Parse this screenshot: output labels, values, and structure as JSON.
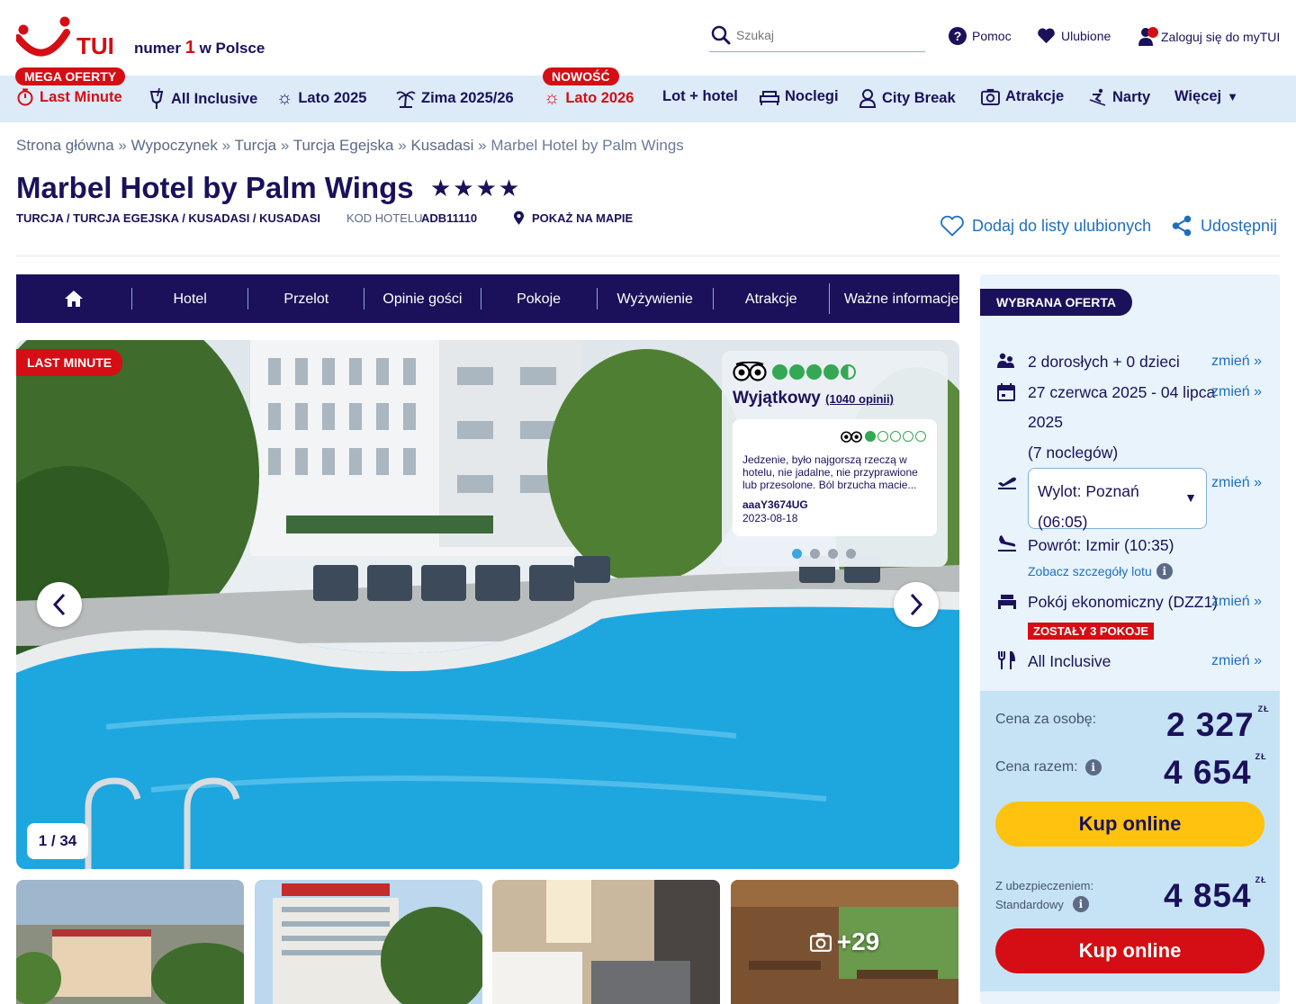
{
  "header": {
    "brand": "TUI",
    "tagline_a": "numer",
    "tagline_num": "1",
    "tagline_b": "w Polsce",
    "search_placeholder": "Szukaj",
    "help": "Pomoc",
    "favorites": "Ulubione",
    "login": "Zaloguj się do myTUI"
  },
  "catnav": {
    "badge_mega": "MEGA OFERTY",
    "badge_new": "NOWOŚĆ",
    "items": [
      "Last Minute",
      "All Inclusive",
      "Lato 2025",
      "Zima 2025/26",
      "Lato 2026",
      "Lot + hotel",
      "Noclegi",
      "City Break",
      "Atrakcje",
      "Narty",
      "Więcej"
    ]
  },
  "breadcrumb": [
    "Strona główna",
    "Wypoczynek",
    "Turcja",
    "Turcja Egejska",
    "Kusadasi",
    "Marbel Hotel by Palm Wings"
  ],
  "breadcrumb_sep": "»",
  "hotel": {
    "name": "Marbel Hotel by Palm Wings",
    "stars": "★★★★",
    "location": "TURCJA / TURCJA EGEJSKA / KUSADASI / KUSADASI",
    "code_label": "KOD HOTELU",
    "code": "ADB11110",
    "map": "POKAŻ NA MAPIE",
    "add_fav": "Dodaj do listy ulubionych",
    "share": "Udostępnij"
  },
  "tabs": [
    "Hotel",
    "Przelot",
    "Opinie gości",
    "Pokoje",
    "Wyżywienie",
    "Atrakcje",
    "Ważne informacje"
  ],
  "gallery": {
    "badge": "LAST MINUTE",
    "counter": "1 / 34",
    "more": "+29"
  },
  "review": {
    "rating_word": "Wyjątkowy",
    "count": "(1040 opinii)",
    "text": "Jedzenie, było najgorszą rzeczą w hotelu, nie jadalne, nie przyprawione lub przesolone. Ból brzucha macie...",
    "user": "aaaY3674UG",
    "date": "2023-08-18",
    "overall_rating": 4.5,
    "review_rating": 1
  },
  "offer": {
    "tag": "WYBRANA OFERTA",
    "travellers": "2 dorosłych + 0 dzieci",
    "dates": "27 czerwca 2025 - 04 lipca",
    "dates_year": "2025",
    "nights": "(7 noclegów)",
    "departure_line1": "Wylot: Poznań",
    "departure_line2": "(06:05)",
    "return": "Powrót: Izmir (10:35)",
    "flight_details": "Zobacz szczegóły lotu",
    "room": "Pokój ekonomiczny (DZZ1)",
    "rooms_left": "ZOSTAŁY 3 POKOJE",
    "board": "All Inclusive",
    "change": "zmień »"
  },
  "prices": {
    "per_person_label": "Cena za osobę:",
    "per_person": "2 327",
    "total_label": "Cena razem:",
    "total": "4 654",
    "currency": "ZŁ",
    "buy": "Kup online",
    "insurance_label1": "Z ubezpieczeniem:",
    "insurance_label2": "Standardowy",
    "insurance_total": "4 854",
    "buy2": "Kup online"
  },
  "colors": {
    "navy": "#1a115a",
    "red": "#d40e14",
    "light_blue": "#dcebf7",
    "yellow": "#ffc20e",
    "link": "#1e6fc0"
  }
}
